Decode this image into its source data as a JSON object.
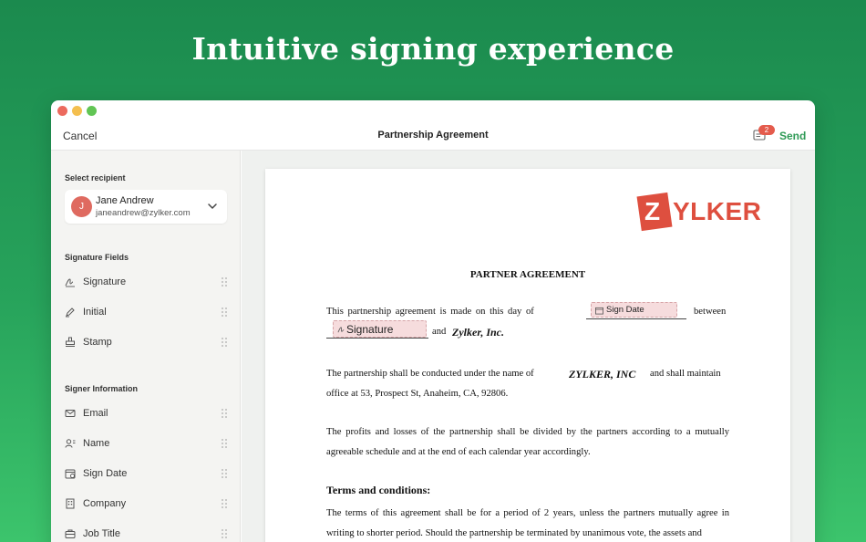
{
  "headline": "Intuitive signing experience",
  "toolbar": {
    "cancel_label": "Cancel",
    "doc_title": "Partnership Agreement",
    "badge_count": "2",
    "send_label": "Send"
  },
  "sidebar": {
    "select_recipient_title": "Select recipient",
    "recipient": {
      "initial": "J",
      "name": "Jane Andrew",
      "email": "janeandrew@zylker.com"
    },
    "signature_fields_title": "Signature Fields",
    "signature_fields": [
      {
        "label": "Signature",
        "icon": "signature-icon"
      },
      {
        "label": "Initial",
        "icon": "pen-icon"
      },
      {
        "label": "Stamp",
        "icon": "stamp-icon"
      }
    ],
    "signer_info_title": "Signer Information",
    "signer_fields": [
      {
        "label": "Email",
        "icon": "mail-icon"
      },
      {
        "label": "Name",
        "icon": "person-icon"
      },
      {
        "label": "Sign Date",
        "icon": "calendar-icon"
      },
      {
        "label": "Company",
        "icon": "building-icon"
      },
      {
        "label": "Job Title",
        "icon": "briefcase-icon"
      }
    ]
  },
  "document": {
    "logo_z": "Z",
    "logo_rest": "YLKER",
    "title": "PARTNER AGREEMENT",
    "p1_start": "This   partnership   agreement   is   made   on   this   day   of",
    "p1_between": "between",
    "sign_date_placeholder": "Sign Date",
    "signature_placeholder": "Signature",
    "p1_and": "and",
    "p1_company": "Zylker, Inc.",
    "p2_start": "The partnership shall be conducted under the name of",
    "p2_company": "ZYLKER, INC",
    "p2_end": "and shall maintain",
    "p2_line2": "office at 53, Prospect St, Anaheim, CA, 92806.",
    "p3": "The profits and losses of the partnership shall be divided by the partners according to a mutually agreeable schedule and at the end of each calendar year accordingly.",
    "terms_heading": "Terms and conditions:",
    "p4": "The terms of this agreement shall be for a period of 2 years, unless the partners mutually agree in writing to shorter period. Should the partnership be terminated by unanimous vote, the assets and"
  },
  "colors": {
    "background_top": "#1b8a4e",
    "background_bottom": "#3cc46c",
    "send": "#2f9a56",
    "badge": "#e45b4c",
    "logo": "#de4f3f",
    "placeholder": "#f6dcdd"
  }
}
